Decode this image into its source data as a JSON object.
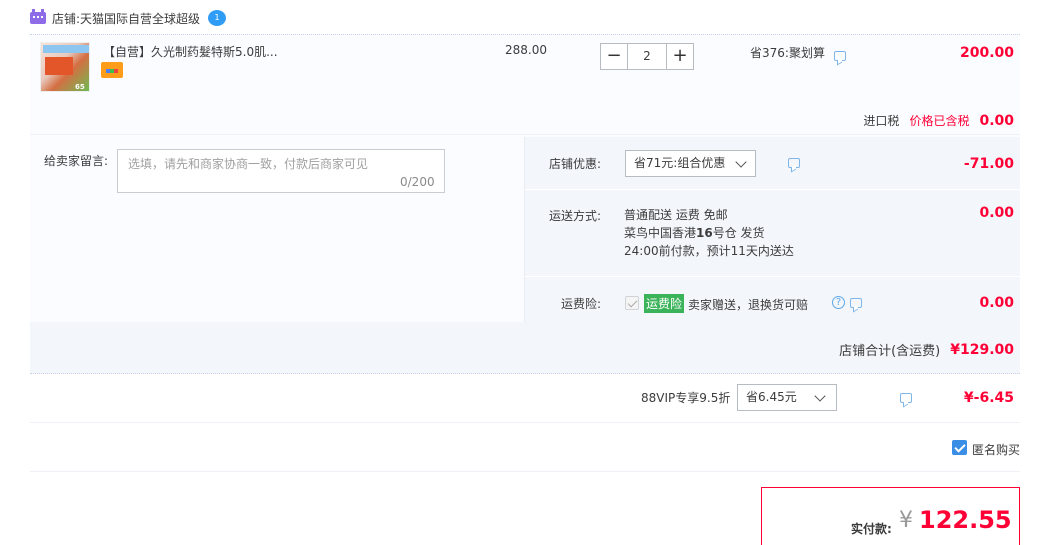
{
  "shop": {
    "label": "店铺:",
    "name": "天猫国际自营全球超级",
    "ww_badge": "1"
  },
  "item": {
    "title": "【自营】久光制药髮特斯5.0肌...",
    "thumb_text": "65",
    "unit_price": "288.00",
    "quantity": "2",
    "qty_minus": "−",
    "qty_plus": "+",
    "promotion": "省376:聚划算",
    "subtotal": "200.00",
    "tax_label": "进口税",
    "tax_included": "价格已含税",
    "tax_value": "0.00"
  },
  "message": {
    "label": "给卖家留言:",
    "placeholder": "选填，请先和商家协商一致，付款后商家可见",
    "count": "0/200"
  },
  "shop_discount": {
    "label": "店铺优惠:",
    "selected": "省71元:组合优惠",
    "value": "-71.00"
  },
  "shipping": {
    "label": "运送方式:",
    "method": "普通配送 运费 免邮",
    "warehouse_prefix": "菜鸟中国香港",
    "warehouse_num": "16",
    "warehouse_suffix": "号仓   发货",
    "eta": "24:00前付款，预计11天内送达",
    "value": "0.00"
  },
  "insurance": {
    "label": "运费险:",
    "badge": "运费险",
    "desc": "卖家赠送，退换货可赔",
    "value": "0.00",
    "help": "?"
  },
  "shop_total": {
    "label": "店铺合计(含运费)",
    "value": "¥129.00"
  },
  "vip": {
    "label": "88VIP专享9.5折",
    "selected": "省6.45元",
    "value": "¥-6.45"
  },
  "anonymous": {
    "label": "匿名购买",
    "checked": true
  },
  "payment": {
    "label": "实付款:",
    "currency": "¥",
    "amount": "122.55"
  },
  "colors": {
    "accent_red": "#ff0036",
    "accent_blue": "#3a8ee6",
    "insurance_green": "#3bb35a"
  }
}
